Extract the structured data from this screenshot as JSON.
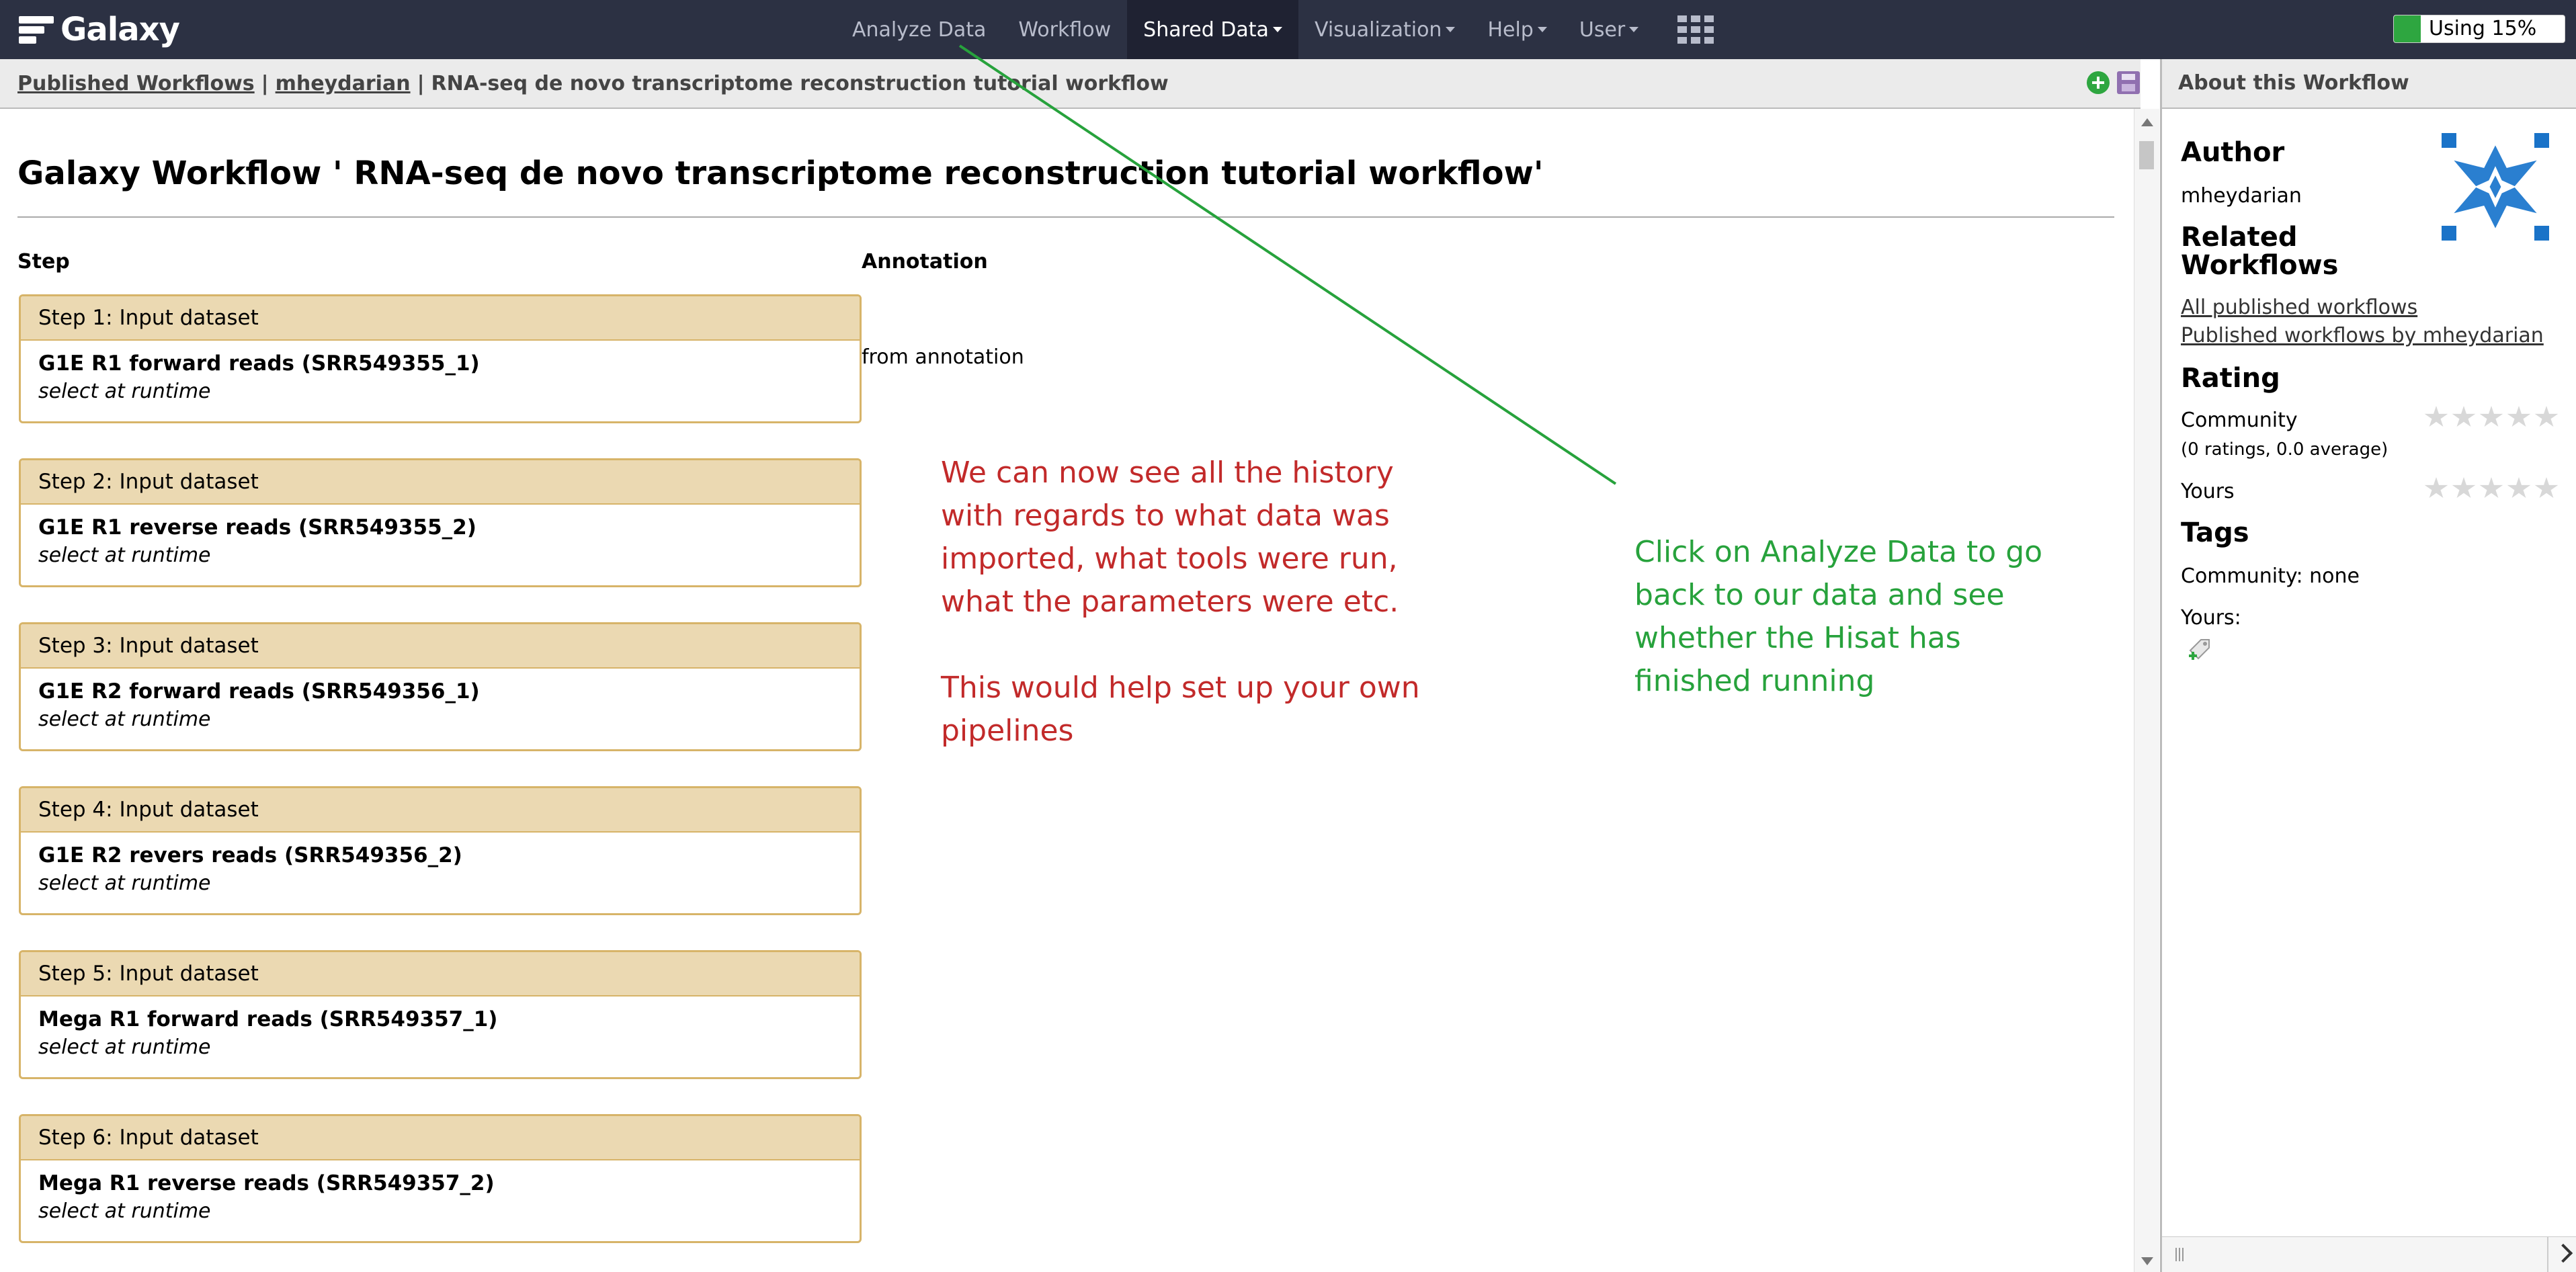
{
  "brand": {
    "name": "Galaxy"
  },
  "nav": {
    "items": [
      {
        "label": "Analyze Data"
      },
      {
        "label": "Workflow"
      },
      {
        "label": "Shared Data"
      },
      {
        "label": "Visualization"
      },
      {
        "label": "Help"
      },
      {
        "label": "User"
      }
    ],
    "quota_label": "Using 15%",
    "quota_percent": 15
  },
  "breadcrumb": {
    "published": "Published Workflows",
    "sep": "|",
    "user": "mheydarian",
    "current": "RNA-seq de novo transcriptome reconstruction tutorial workflow"
  },
  "page": {
    "title": "Galaxy Workflow ' RNA-seq de novo transcriptome reconstruction tutorial workflow'",
    "col_step": "Step",
    "col_annotation": "Annotation",
    "annotation_text": "from annotation",
    "steps": [
      {
        "head": "Step 1: Input dataset",
        "name": "G1E R1 forward reads (SRR549355_1)",
        "sub": "select at runtime"
      },
      {
        "head": "Step 2: Input dataset",
        "name": "G1E R1 reverse reads (SRR549355_2)",
        "sub": "select at runtime"
      },
      {
        "head": "Step 3: Input dataset",
        "name": "G1E R2 forward reads (SRR549356_1)",
        "sub": "select at runtime"
      },
      {
        "head": "Step 4: Input dataset",
        "name": "G1E R2 revers reads (SRR549356_2)",
        "sub": "select at runtime"
      },
      {
        "head": "Step 5: Input dataset",
        "name": "Mega R1 forward reads (SRR549357_1)",
        "sub": "select at runtime"
      },
      {
        "head": "Step 6: Input dataset",
        "name": "Mega R1 reverse reads (SRR549357_2)",
        "sub": "select at runtime"
      }
    ]
  },
  "callouts": {
    "red_p1": "We can now see all the history with regards to what data was imported, what tools were run, what the parameters were etc.",
    "red_p2": "This would help set up your own pipelines",
    "green": "Click on Analyze Data to go back to our data and see whether the Hisat has finished running",
    "colors": {
      "red": "#c22a2a",
      "green": "#27a23c"
    }
  },
  "about": {
    "title": "About this Workflow",
    "author_heading": "Author",
    "author": "mheydarian",
    "related_heading": "Related Workflows",
    "link_all": "All published workflows",
    "link_by_user": "Published workflows by mheydarian",
    "rating_heading": "Rating",
    "community_label": "Community",
    "ratings_summary": "(0 ratings, 0.0 average)",
    "yours_label": "Yours",
    "tags_heading": "Tags",
    "tags_community": "Community: none",
    "tags_yours": "Yours:"
  }
}
